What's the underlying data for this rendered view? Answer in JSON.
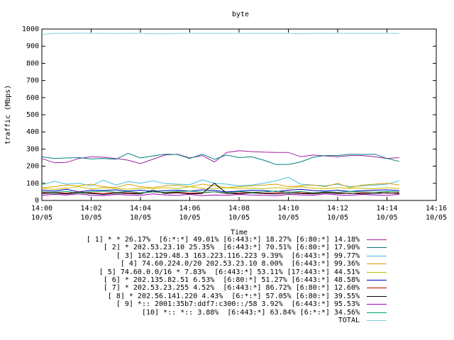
{
  "chart_data": {
    "type": "line",
    "title": "byte",
    "xlabel": "Time",
    "ylabel": "traffic (Mbps)",
    "ylim": [
      0,
      1000
    ],
    "xlim": [
      "14:00",
      "14:16"
    ],
    "yticks": [
      "0",
      "100",
      "200",
      "300",
      "400",
      "500",
      "600",
      "700",
      "800",
      "900",
      "1000"
    ],
    "xticks": [
      {
        "time": "14:00",
        "date": "10/05"
      },
      {
        "time": "14:02",
        "date": "10/05"
      },
      {
        "time": "14:04",
        "date": "10/05"
      },
      {
        "time": "14:06",
        "date": "10/05"
      },
      {
        "time": "14:08",
        "date": "10/05"
      },
      {
        "time": "14:10",
        "date": "10/05"
      },
      {
        "time": "14:12",
        "date": "10/05"
      },
      {
        "time": "14:14",
        "date": "10/05"
      },
      {
        "time": "14:16",
        "date": "10/05"
      }
    ],
    "grid": false,
    "legend_position": "bottom",
    "x": [
      "14:00",
      "14:00:30",
      "14:01",
      "14:01:30",
      "14:02",
      "14:02:30",
      "14:03",
      "14:03:30",
      "14:04",
      "14:04:30",
      "14:05",
      "14:05:30",
      "14:06",
      "14:06:30",
      "14:07",
      "14:07:30",
      "14:08",
      "14:08:30",
      "14:09",
      "14:09:30",
      "14:10",
      "14:10:30",
      "14:11",
      "14:11:30",
      "14:12",
      "14:12:30",
      "14:13",
      "14:13:30",
      "14:14",
      "14:14:30"
    ],
    "series": [
      {
        "name": "[ 1] * * 26.17%  [6:*:*] 49.01% [6:443:*] 18.27% [6:80:*] 14.18%",
        "color": "#a020a0",
        "values": [
          245,
          220,
          222,
          245,
          255,
          252,
          245,
          235,
          215,
          240,
          265,
          270,
          248,
          262,
          225,
          280,
          290,
          285,
          282,
          280,
          280,
          255,
          265,
          260,
          255,
          262,
          262,
          255,
          245,
          250
        ]
      },
      {
        "name": "[ 2] * 202.53.23.10 25.35%  [6:443:*] 70.51% [6:80:*] 17.90%",
        "color": "#008080",
        "values": [
          255,
          245,
          248,
          250,
          242,
          245,
          240,
          275,
          248,
          260,
          270,
          268,
          245,
          270,
          240,
          265,
          250,
          255,
          235,
          210,
          210,
          225,
          252,
          262,
          262,
          270,
          268,
          270,
          245,
          228
        ]
      },
      {
        "name": "[ 3] 162.129.48.3 163.223.116.223 9.39%  [6:443:*] 99.77%",
        "color": "#40c0e0",
        "values": [
          90,
          112,
          95,
          100,
          85,
          118,
          90,
          110,
          100,
          115,
          98,
          95,
          92,
          120,
          100,
          95,
          85,
          90,
          100,
          115,
          135,
          95,
          90,
          85,
          95,
          80,
          85,
          90,
          95,
          115
        ]
      },
      {
        "name": "[ 4] 74.60.224.0/20 202.53.23.10 8.00%  [6:443:*] 99.36%",
        "color": "#e0a000",
        "values": [
          75,
          80,
          90,
          85,
          95,
          80,
          75,
          95,
          80,
          75,
          85,
          90,
          80,
          95,
          85,
          75,
          80,
          85,
          90,
          95,
          80,
          85,
          90,
          80,
          100,
          75,
          90,
          95,
          100,
          90
        ]
      },
      {
        "name": "[ 5] 74.60.0.0/16 * 7.83%  [6:443:*] 53.11% [17:443:*] 44.51%",
        "color": "#c0c000",
        "values": [
          70,
          65,
          72,
          80,
          68,
          75,
          70,
          65,
          72,
          68,
          75,
          70,
          80,
          72,
          68,
          75,
          70,
          72,
          68,
          75,
          70,
          80,
          72,
          68,
          75,
          70,
          72,
          68,
          75,
          70
        ]
      },
      {
        "name": "[ 6] * 202.135.82.51 6.53%  [6:80:*] 51.27% [6:443:*] 48.58%",
        "color": "#0000c0",
        "values": [
          60,
          55,
          65,
          50,
          60,
          58,
          62,
          55,
          60,
          52,
          58,
          60,
          55,
          62,
          58,
          50,
          55,
          60,
          58,
          52,
          60,
          65,
          58,
          55,
          60,
          52,
          58,
          60,
          62,
          58
        ]
      },
      {
        "name": "[ 7] * 202.53.23.255 4.52%  [6:443:*] 86.72% [6:80:*] 12.60%",
        "color": "#c00000",
        "values": [
          45,
          48,
          42,
          50,
          45,
          40,
          48,
          45,
          42,
          50,
          45,
          48,
          42,
          45,
          50,
          40,
          45,
          48,
          42,
          45,
          50,
          45,
          42,
          48,
          45,
          40,
          45,
          48,
          42,
          45
        ]
      },
      {
        "name": "[ 8] * 202.56.141.220 4.43%  [6:*:*] 57.05% [6:80:*] 39.55%",
        "color": "#000000",
        "values": [
          40,
          42,
          38,
          45,
          40,
          35,
          42,
          40,
          38,
          60,
          40,
          45,
          38,
          40,
          100,
          42,
          38,
          45,
          40,
          38,
          42,
          40,
          38,
          45,
          40,
          42,
          38,
          40,
          45,
          40
        ]
      },
      {
        "name": "[ 9] *:: 2001:35b7:ddf7:c300::/58 3.92%  [6:443:*] 95.53%",
        "color": "#a000c0",
        "values": [
          30,
          35,
          32,
          38,
          30,
          28,
          35,
          32,
          30,
          38,
          32,
          30,
          35,
          28,
          32,
          30,
          35,
          32,
          30,
          28,
          35,
          32,
          30,
          38,
          32,
          30,
          35,
          32,
          30,
          35
        ]
      },
      {
        "name": "[10] *:: *:: 3.88%  [6:443:*] 63.84% [6:*:*] 34.56%",
        "color": "#00a060",
        "values": [
          50,
          48,
          52,
          45,
          50,
          55,
          48,
          52,
          45,
          50,
          48,
          52,
          55,
          48,
          50,
          45,
          52,
          48,
          50,
          55,
          48,
          52,
          45,
          50,
          48,
          52,
          50,
          48,
          52,
          50
        ]
      },
      {
        "name": "TOTAL",
        "color": "#80d0e0",
        "values": [
          968,
          975,
          975,
          976,
          975,
          975,
          974,
          975,
          975,
          972,
          972,
          975,
          975,
          975,
          975,
          975,
          975,
          975,
          975,
          975,
          975,
          972,
          975,
          975,
          975,
          975,
          975,
          975,
          975,
          975
        ]
      }
    ]
  }
}
